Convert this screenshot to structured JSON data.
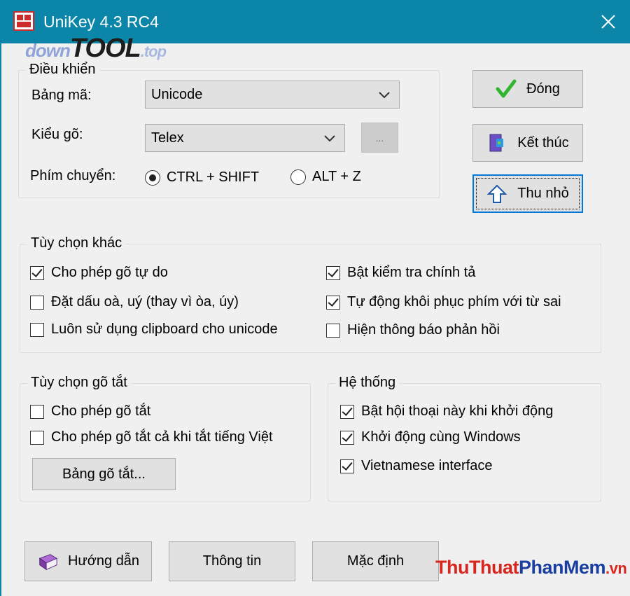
{
  "window": {
    "title": "UniKey 4.3 RC4",
    "accent": "#0b86a8"
  },
  "watermark_top": {
    "part1": "down",
    "part2": "TOOL",
    "part3": ".top"
  },
  "control_group": {
    "legend": "Điều khiển",
    "charset_label": "Bảng mã:",
    "charset_value": "Unicode",
    "input_method_label": "Kiểu gõ:",
    "input_method_value": "Telex",
    "ellipsis_button": "...",
    "switch_key_label": "Phím chuyển:",
    "switch_options": [
      {
        "label": "CTRL + SHIFT",
        "selected": true
      },
      {
        "label": "ALT + Z",
        "selected": false
      }
    ]
  },
  "side_buttons": {
    "close_label": "Đóng",
    "exit_label": "Kết thúc",
    "minimize_label": "Thu nhỏ"
  },
  "other_options": {
    "legend": "Tùy chọn khác",
    "left": [
      {
        "label": "Cho phép gõ tự do",
        "checked": true
      },
      {
        "label": "Đặt dấu oà, uý (thay vì òa, úy)",
        "checked": false
      },
      {
        "label": "Luôn sử dụng clipboard cho unicode",
        "checked": false
      }
    ],
    "right": [
      {
        "label": "Bật kiểm tra chính tả",
        "checked": true
      },
      {
        "label": "Tự động khôi phục phím với từ sai",
        "checked": true
      },
      {
        "label": "Hiện thông báo phản hồi",
        "checked": false
      }
    ]
  },
  "shortcut_options": {
    "legend": "Tùy chọn gõ tắt",
    "items": [
      {
        "label": "Cho phép gõ tắt",
        "checked": false
      },
      {
        "label": "Cho phép gõ tắt cả khi tắt tiếng Việt",
        "checked": false
      }
    ],
    "table_button": "Bảng gõ tắt..."
  },
  "system": {
    "legend": "Hệ thống",
    "items": [
      {
        "label": "Bật hội thoại này khi khởi động",
        "checked": true
      },
      {
        "label": "Khởi động cùng Windows",
        "checked": true
      },
      {
        "label": "Vietnamese interface",
        "checked": true
      }
    ]
  },
  "bottom_buttons": {
    "help_label": "Hướng dẫn",
    "info_label": "Thông tin",
    "default_label": "Mặc định"
  },
  "watermark_bottom": {
    "part1": "Thu",
    "part2": "Thuat",
    "part3": "PhanMem",
    "part4": ".vn"
  }
}
